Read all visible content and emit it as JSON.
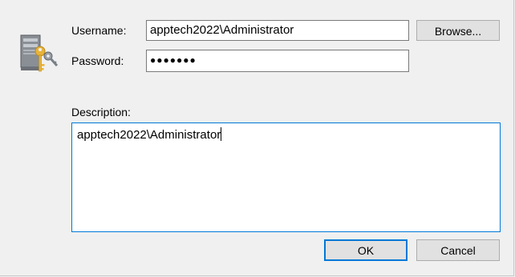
{
  "form": {
    "username_label": "Username:",
    "username_value": "apptech2022\\Administrator",
    "password_label": "Password:",
    "password_mask": "●●●●●●●",
    "description_label": "Description:",
    "description_value": "apptech2022\\Administrator"
  },
  "buttons": {
    "browse_label": "Browse...",
    "ok_label": "OK",
    "cancel_label": "Cancel"
  },
  "icons": {
    "credential": "key-and-computer-icon"
  },
  "colors": {
    "focus_border": "#0078d7",
    "dialog_bg": "#f0f0f0",
    "key_gold": "#e8b33a"
  }
}
